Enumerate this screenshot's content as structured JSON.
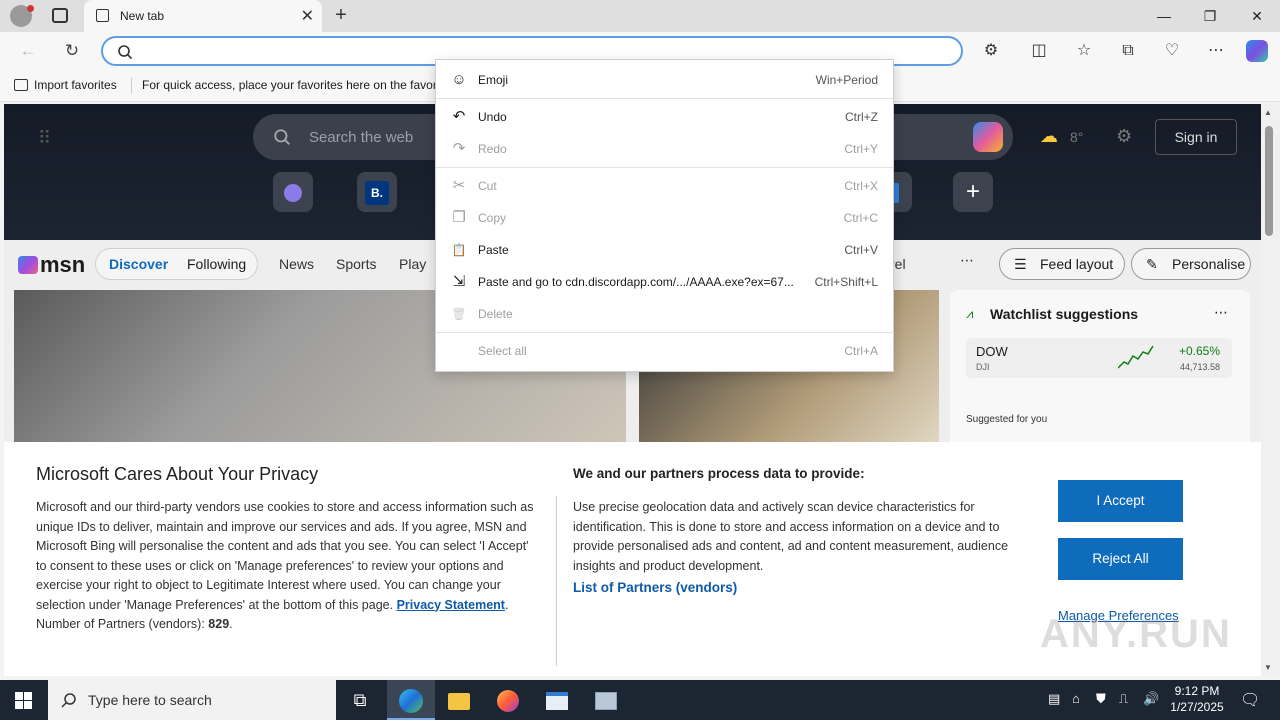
{
  "browser": {
    "tab_title": "New tab",
    "tab_close": "✕",
    "new_tab": "+",
    "window_controls": {
      "minimize": "—",
      "maximize": "❐",
      "close": "✕"
    },
    "address_value": "",
    "favorites_bar": {
      "import_label": "Import favorites",
      "hint": "For quick access, place your favorites here on the favorit"
    }
  },
  "msn": {
    "search_placeholder": "Search the web",
    "tile_b": "B.",
    "signin": "Sign in",
    "weather": "8°",
    "logo": "msn",
    "tabs": [
      "Discover",
      "Following"
    ],
    "nav": [
      "News",
      "Sports",
      "Play",
      "rel"
    ],
    "feed_layout": "Feed layout",
    "personalise": "Personalise",
    "watchlist": {
      "title": "Watchlist suggestions",
      "symbol": "DOW",
      "exchange": "DJI",
      "change": "+0.65%",
      "price": "44,713.58",
      "suggested": "Suggested for you"
    }
  },
  "context_menu": {
    "items": [
      {
        "label": "Emoji",
        "shortcut": "Win+Period",
        "icon": "☺",
        "disabled": false
      },
      {
        "label": "Undo",
        "shortcut": "Ctrl+Z",
        "icon": "↶",
        "disabled": false
      },
      {
        "label": "Redo",
        "shortcut": "Ctrl+Y",
        "icon": "↷",
        "disabled": true
      },
      {
        "label": "Cut",
        "shortcut": "Ctrl+X",
        "icon": "✂",
        "disabled": true
      },
      {
        "label": "Copy",
        "shortcut": "Ctrl+C",
        "icon": "❐",
        "disabled": true
      },
      {
        "label": "Paste",
        "shortcut": "Ctrl+V",
        "icon": "📋",
        "disabled": false
      },
      {
        "label": "Paste and go to cdn.discordapp.com/.../AAAA.exe?ex=67...",
        "shortcut": "Ctrl+Shift+L",
        "icon": "⇲",
        "disabled": false
      },
      {
        "label": "Delete",
        "shortcut": "",
        "icon": "🗑",
        "disabled": true
      },
      {
        "label": "Select all",
        "shortcut": "Ctrl+A",
        "icon": "",
        "disabled": true
      }
    ]
  },
  "privacy": {
    "title": "Microsoft Cares About Your Privacy",
    "body": "Microsoft and our third-party vendors use cookies to store and access information such as unique IDs to deliver, maintain and improve our services and ads. If you agree, MSN and Microsoft Bing will personalise the content and ads that you see. You can select 'I Accept' to consent to these uses or click on 'Manage preferences' to review your options and exercise your right to object to Legitimate Interest where used.  You can change your selection under 'Manage Preferences' at the bottom of this page.",
    "privacy_link": "Privacy Statement",
    "partners_count_label": "Number of Partners (vendors):",
    "partners_count": "829",
    "right_title": "We and our partners process data to provide:",
    "right_body": "Use precise geolocation data and actively scan device characteristics for identification. This is done to store and access information on a device and to provide personalised ads and content, ad and content measurement, audience insights and product development.",
    "partners_link": "List of Partners (vendors)",
    "accept": "I Accept",
    "reject": "Reject All",
    "manage": "Manage Preferences"
  },
  "watermark": "ANY.RUN",
  "taskbar": {
    "search_placeholder": "Type here to search",
    "time": "9:12 PM",
    "date": "1/27/2025"
  }
}
